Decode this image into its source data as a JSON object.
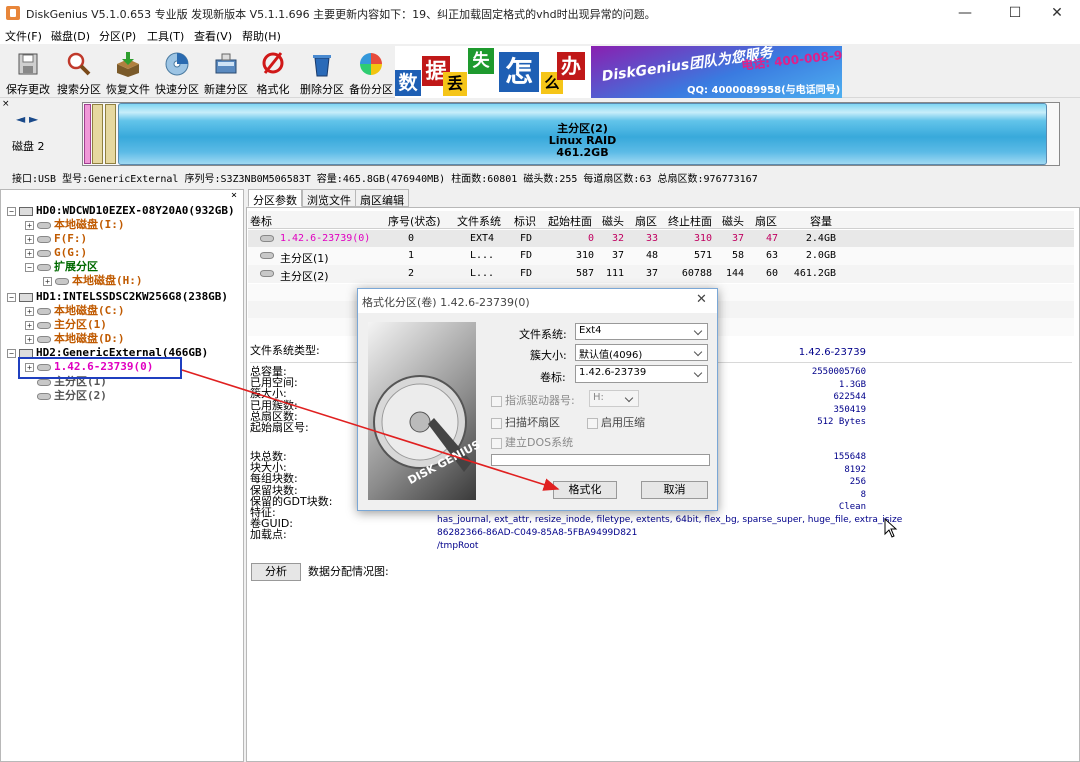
{
  "window": {
    "title": "DiskGenius V5.1.0.653 专业版  发现新版本 V5.1.1.696 主要更新内容如下：19、纠正加载固定格式的vhd时出现异常的问题。",
    "min": "—",
    "max": "☐",
    "close": "✕"
  },
  "menu": [
    "文件(F)",
    "磁盘(D)",
    "分区(P)",
    "工具(T)",
    "查看(V)",
    "帮助(H)"
  ],
  "toolbar": [
    {
      "label": "保存更改",
      "icon": "save-disk-icon"
    },
    {
      "label": "搜索分区",
      "icon": "magnifier-icon"
    },
    {
      "label": "恢复文件",
      "icon": "recover-box-icon"
    },
    {
      "label": "快速分区",
      "icon": "quick-partition-disc-icon"
    },
    {
      "label": "新建分区",
      "icon": "new-partition-icon"
    },
    {
      "label": "格式化",
      "icon": "format-icon"
    },
    {
      "label": "删除分区",
      "icon": "trash-bin-icon"
    },
    {
      "label": "备份分区",
      "icon": "backup-pie-icon"
    }
  ],
  "banner": {
    "chars": [
      "数",
      "据",
      "丢",
      "失",
      "怎",
      "么",
      "办"
    ],
    "slogan": "DiskGenius团队为您服务",
    "phone": "电话: 400-008-9958",
    "qq": "QQ: 4000089958(与电话同号)"
  },
  "diskmap": {
    "nav_arrows": "◄ ►",
    "disk_label": "磁盘 2",
    "partition_title": "主分区(2)",
    "partition_fs": "Linux RAID",
    "partition_size": "461.2GB"
  },
  "diskinfo": "接口:USB   型号:GenericExternal   序列号:S3Z3NB0M506583T   容量:465.8GB(476940MB)   柱面数:60801   磁头数:255   每道扇区数:63   总扇区数:976773167",
  "tree": [
    {
      "text": "HD0:WDCWD10EZEX-08Y20A0(932GB)",
      "level": 0,
      "style": "bold",
      "expander": "−",
      "icon": "hdd"
    },
    {
      "text": "本地磁盘(I:)",
      "level": 1,
      "style": "orange",
      "expander": "+",
      "icon": "part"
    },
    {
      "text": "F(F:)",
      "level": 1,
      "style": "orange",
      "expander": "+",
      "icon": "part"
    },
    {
      "text": "G(G:)",
      "level": 1,
      "style": "orange",
      "expander": "+",
      "icon": "part"
    },
    {
      "text": "扩展分区",
      "level": 1,
      "style": "green",
      "expander": "−",
      "icon": "ext"
    },
    {
      "text": "本地磁盘(H:)",
      "level": 2,
      "style": "orange",
      "expander": "+",
      "icon": "part"
    },
    {
      "text": "HD1:INTELSSDSC2KW256G8(238GB)",
      "level": 0,
      "style": "bold",
      "expander": "−",
      "icon": "hdd"
    },
    {
      "text": "本地磁盘(C:)",
      "level": 1,
      "style": "orange",
      "expander": "+",
      "icon": "part"
    },
    {
      "text": "主分区(1)",
      "level": 1,
      "style": "orange",
      "expander": "+",
      "icon": "part"
    },
    {
      "text": "本地磁盘(D:)",
      "level": 1,
      "style": "orange",
      "expander": "+",
      "icon": "part"
    },
    {
      "text": "HD2:GenericExternal(466GB)",
      "level": 0,
      "style": "bold",
      "expander": "−",
      "icon": "hdd"
    },
    {
      "text": "1.42.6-23739(0)",
      "level": 1,
      "style": "pink",
      "expander": "+",
      "icon": "part"
    },
    {
      "text": "主分区(1)",
      "level": 1,
      "style": "gray",
      "expander": "",
      "icon": "part"
    },
    {
      "text": "主分区(2)",
      "level": 1,
      "style": "gray",
      "expander": "",
      "icon": "part"
    }
  ],
  "tabs": [
    "分区参数",
    "浏览文件",
    "扇区编辑"
  ],
  "table": {
    "headers": [
      "卷标",
      "序号(状态)",
      "文件系统",
      "标识",
      "起始柱面",
      "磁头",
      "扇区",
      "终止柱面",
      "磁头",
      "扇区",
      "容量"
    ],
    "rows": [
      [
        "1.42.6-23739(0)",
        "0",
        "EXT4",
        "FD",
        "0",
        "32",
        "33",
        "310",
        "37",
        "47",
        "2.4GB"
      ],
      [
        "主分区(1)",
        "1",
        "L...",
        "FD",
        "310",
        "37",
        "48",
        "571",
        "58",
        "63",
        "2.0GB"
      ],
      [
        "主分区(2)",
        "2",
        "L...",
        "FD",
        "587",
        "111",
        "37",
        "60788",
        "144",
        "60",
        "461.2GB"
      ]
    ]
  },
  "fs_info": {
    "fs_type_label": "文件系统类型:",
    "fs_type_value": "1.42.6-23739",
    "group1_labels": [
      "总容量:",
      "已用空间:",
      "簇大小:",
      "已用簇数:",
      "总扇区数:",
      "起始扇区号:"
    ],
    "group1_values": [
      "2550005760",
      "1.3GB",
      "622544",
      "350419",
      "512 Bytes"
    ],
    "group2_labels": [
      "块总数:",
      "块大小:",
      "每组块数:",
      "保留块数:",
      "保留的GDT块数:",
      "特征:",
      "卷GUID:",
      "加载点:"
    ],
    "group2_values": [
      "155648",
      "8192",
      "256",
      "8",
      "Clean"
    ],
    "features": "has_journal, ext_attr, resize_inode, filetype, extents, 64bit, flex_bg, sparse_super, huge_file, extra_isize",
    "guid": "86282366-86AD-C049-85A8-5FBA9499D821",
    "mount": "/tmpRoot",
    "analyze_button": "分析",
    "distribution_label": "数据分配情况图:"
  },
  "dialog": {
    "title": "格式化分区(卷) 1.42.6-23739(0)",
    "fs_label": "文件系统:",
    "fs_value": "Ext4",
    "cluster_label": "簇大小:",
    "cluster_value": "默认值(4096)",
    "volume_label": "卷标:",
    "volume_value": "1.42.6-23739",
    "drive_letter_label": "指派驱动器号:",
    "drive_letter_value": "H:",
    "scan_bad": "扫描坏扇区",
    "compress": "启用压缩",
    "dos_system": "建立DOS系统",
    "format_button": "格式化",
    "cancel_button": "取消",
    "brand": "DISK GENIUS"
  },
  "colors": {
    "selection_box": "#1f3fbf",
    "arrow": "#e02020",
    "partition_bar": "#38a9db",
    "pink_text": "#e000c0"
  }
}
